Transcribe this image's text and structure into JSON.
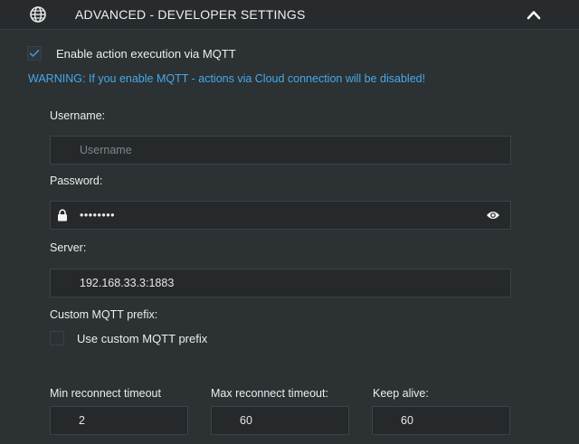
{
  "header": {
    "title": "ADVANCED - DEVELOPER SETTINGS",
    "icon": "globe-icon",
    "toggle_icon": "chevron-up-icon"
  },
  "mqtt": {
    "enable_label": "Enable action execution via MQTT",
    "enable_checked": true,
    "warning": "WARNING: If you enable MQTT - actions via Cloud connection will be disabled!",
    "warning_color": "#46a9e8"
  },
  "username": {
    "label": "Username:",
    "value": "",
    "placeholder": "Username"
  },
  "password": {
    "label": "Password:",
    "value": "••••••••",
    "icon": "lock-icon",
    "reveal_icon": "eye-icon"
  },
  "server": {
    "label": "Server:",
    "value": "192.168.33.3:1883"
  },
  "custom_prefix": {
    "label": "Custom MQTT prefix:",
    "checkbox_label": "Use custom MQTT prefix",
    "checked": false
  },
  "timeouts": {
    "min_label": "Min reconnect timeout",
    "min_value": "2",
    "max_label": "Max reconnect timeout:",
    "max_value": "60",
    "keepalive_label": "Keep alive:",
    "keepalive_value": "60"
  }
}
